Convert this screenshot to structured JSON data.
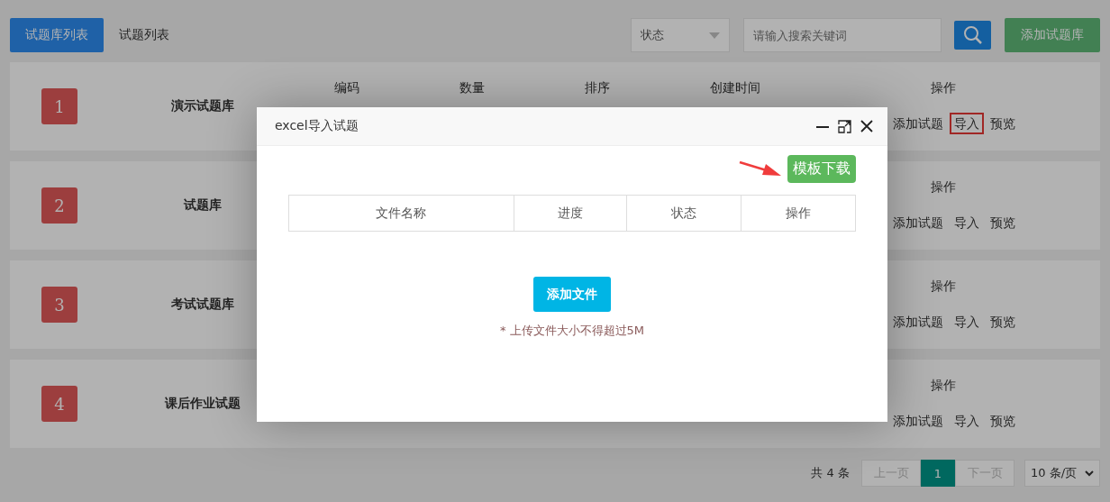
{
  "tabs": [
    {
      "label": "试题库列表",
      "selected": true
    },
    {
      "label": "试题列表",
      "selected": false
    }
  ],
  "toolbar": {
    "status_select": "状态",
    "search": {
      "placeholder": "请输入搜索关键词"
    },
    "add_button": "添加试题库"
  },
  "banks": [
    {
      "number": "1",
      "name": "演示试题库",
      "columns": [
        "编码",
        "数量",
        "排序",
        "创建时间"
      ],
      "actions_header": "操作",
      "actions": [
        {
          "label": "添加试题",
          "highlighted": false
        },
        {
          "label": "导入",
          "highlighted": true
        },
        {
          "label": "预览",
          "highlighted": false
        }
      ]
    },
    {
      "number": "2",
      "name": "试题库",
      "actions_header": "操作",
      "actions": [
        {
          "label": "添加试题",
          "highlighted": false
        },
        {
          "label": "导入",
          "highlighted": false
        },
        {
          "label": "预览",
          "highlighted": false
        }
      ]
    },
    {
      "number": "3",
      "name": "考试试题库",
      "actions_header": "操作",
      "actions": [
        {
          "label": "添加试题",
          "highlighted": false
        },
        {
          "label": "导入",
          "highlighted": false
        },
        {
          "label": "预览",
          "highlighted": false
        }
      ]
    },
    {
      "number": "4",
      "name": "课后作业试题",
      "actions_header": "操作",
      "actions": [
        {
          "label": "添加试题",
          "highlighted": false
        },
        {
          "label": "导入",
          "highlighted": false
        },
        {
          "label": "预览",
          "highlighted": false
        }
      ]
    }
  ],
  "pagination": {
    "total": "共 4 条",
    "prev": "上一页",
    "pages": [
      {
        "label": "1",
        "selected": true
      }
    ],
    "next": "下一页",
    "page_size": "10 条/页"
  },
  "dialog": {
    "title": "excel导入试题",
    "template_button": "模板下载",
    "table_columns": [
      "文件名称",
      "进度",
      "状态",
      "操作"
    ],
    "add_file_button": "添加文件",
    "note": "* 上传文件大小不得超过5M"
  }
}
